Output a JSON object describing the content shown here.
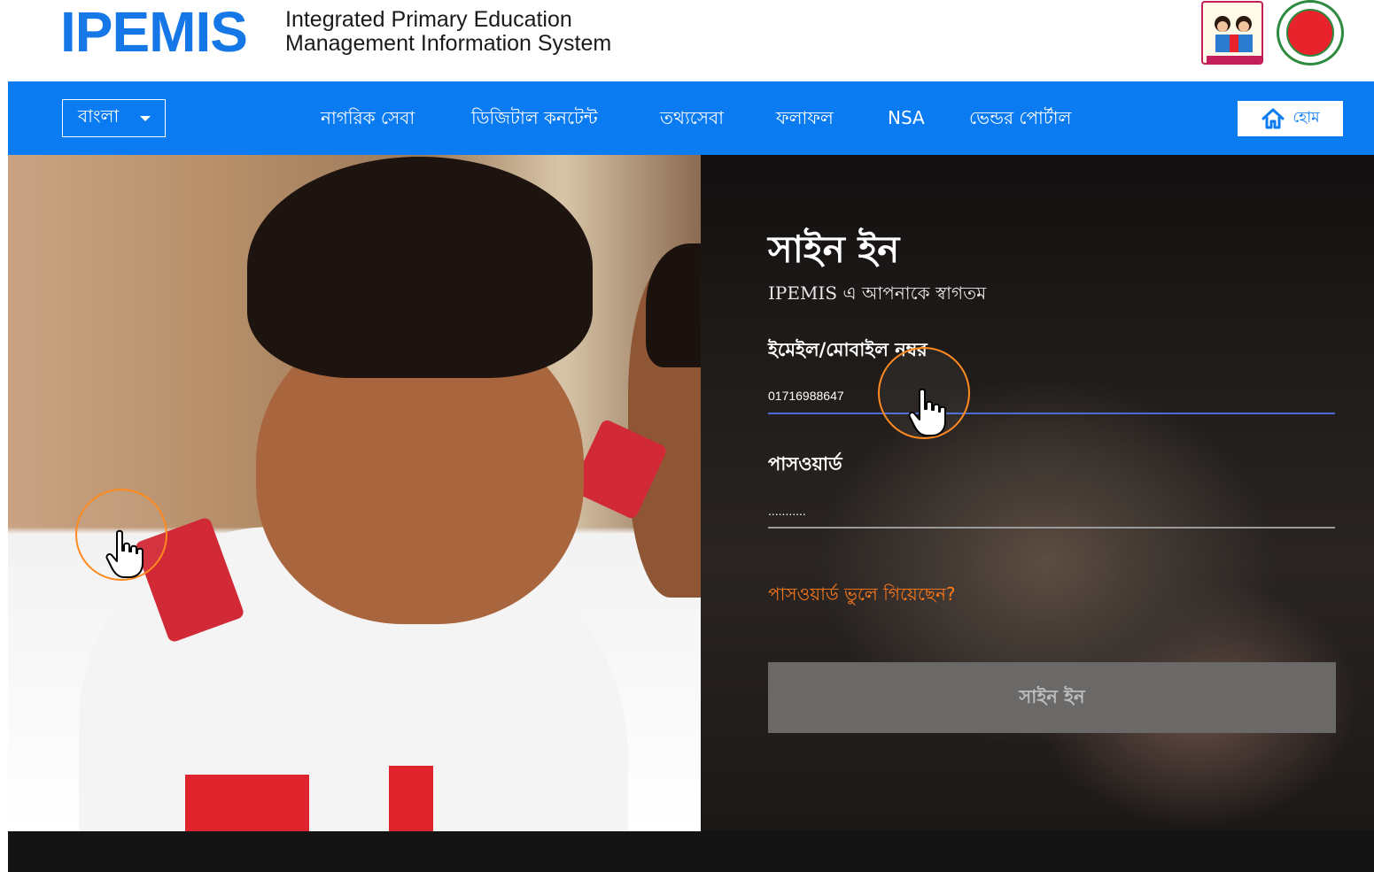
{
  "header": {
    "logo_text": "IPEMIS",
    "subtitle_line1": "Integrated Primary Education",
    "subtitle_line2": "Management Information System"
  },
  "navbar": {
    "language": "বাংলা",
    "items": [
      {
        "label": "নাগরিক সেবা"
      },
      {
        "label": "ডিজিটাল কনটেন্ট"
      },
      {
        "label": "তথ্যসেবা"
      },
      {
        "label": "ফলাফল"
      },
      {
        "label": "NSA"
      },
      {
        "label": "ভেন্ডর পোর্টাল"
      }
    ],
    "home_label": "হোম"
  },
  "signin": {
    "title": "সাইন ইন",
    "welcome": "IPEMIS এ আপনাকে স্বাগতম",
    "email_label": "ইমেইল/মোবাইল নম্বর",
    "email_value": "01716988647",
    "password_label": "পাসওয়ার্ড",
    "password_value": "...........",
    "forgot_label": "পাসওয়ার্ড ভুলে গিয়েছেন?",
    "submit_label": "সাইন ইন"
  },
  "colors": {
    "brand_blue": "#0b7bf2",
    "accent_orange": "#ff7a1a",
    "footer_dark": "#141414"
  },
  "icons": {
    "home": "home-icon",
    "caret": "chevron-down-icon",
    "cursor": "hand-pointer-icon"
  }
}
